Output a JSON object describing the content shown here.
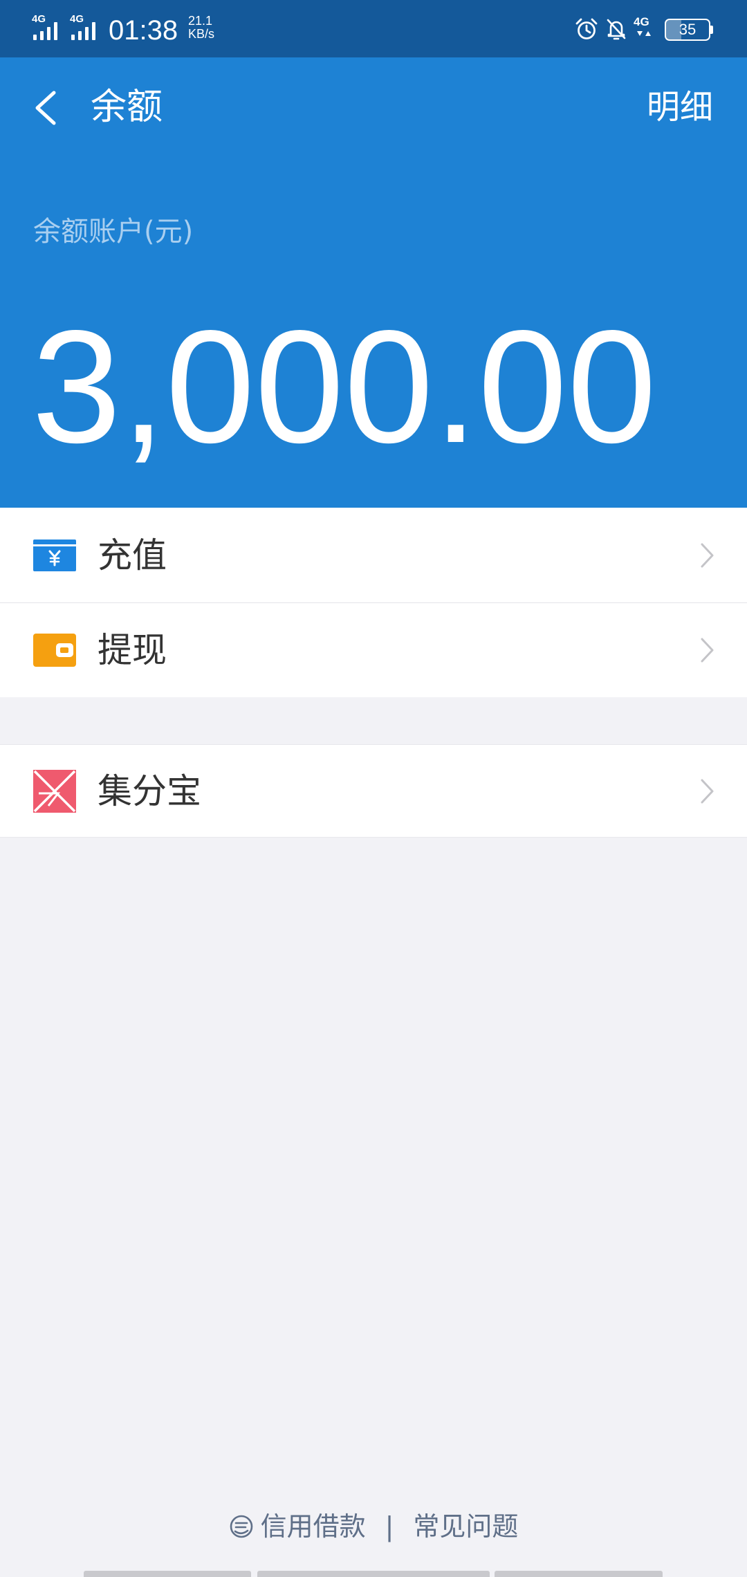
{
  "status_bar": {
    "sim1_network": "4G",
    "sim2_network": "4G",
    "time": "01:38",
    "speed_value": "21.1",
    "speed_unit": "KB/s",
    "data_network": "4G",
    "battery_level": "35",
    "battery_fraction": 0.35,
    "icons": [
      "signal-icon",
      "signal-icon",
      "alarm-icon",
      "bell-off-icon",
      "data-arrows-icon",
      "battery-icon"
    ]
  },
  "header": {
    "back_icon": "chevron-left-icon",
    "title": "余额",
    "detail_link": "明细"
  },
  "balance": {
    "label": "余额账户(元)",
    "amount": "3,000.00"
  },
  "menu_group_1": [
    {
      "label": "充值",
      "icon": "recharge-card-icon"
    },
    {
      "label": "提现",
      "icon": "wallet-icon"
    }
  ],
  "menu_group_2": [
    {
      "label": "集分宝",
      "icon": "jifenbao-icon"
    }
  ],
  "footer": {
    "credit_icon": "credit-loan-icon",
    "credit_link": "信用借款",
    "separator": "|",
    "faq_link": "常见问题"
  },
  "colors": {
    "status_bar": "#14599a",
    "header": "#1e82d4",
    "background": "#f2f2f6",
    "recharge_icon": "#1e86e0",
    "withdraw_icon": "#f5a010",
    "jifenbao_icon": "#ef5a6e",
    "footer_link": "#5f6f88"
  }
}
